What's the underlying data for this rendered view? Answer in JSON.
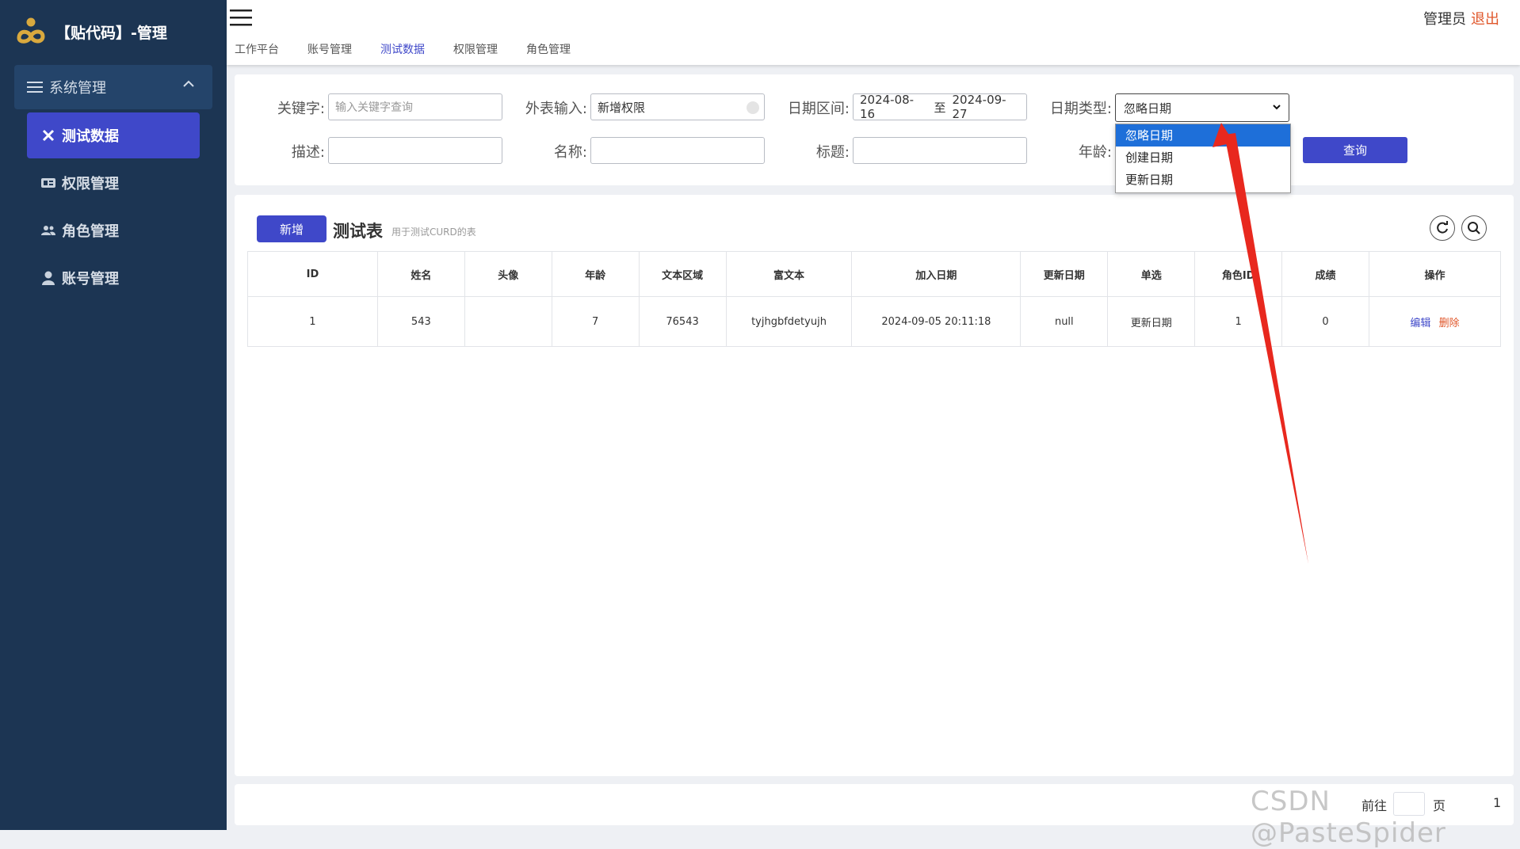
{
  "app": {
    "title": "【贴代码】-管理"
  },
  "sidebar": {
    "group_label": "系统管理",
    "items": [
      {
        "label": "测试数据",
        "icon": "close-icon",
        "active": true
      },
      {
        "label": "权限管理",
        "icon": "id-card-icon",
        "active": false
      },
      {
        "label": "角色管理",
        "icon": "users-icon",
        "active": false
      },
      {
        "label": "账号管理",
        "icon": "user-icon",
        "active": false
      }
    ]
  },
  "header": {
    "user": "管理员",
    "logout": "退出",
    "tabs": [
      {
        "label": "工作平台"
      },
      {
        "label": "账号管理"
      },
      {
        "label": "测试数据",
        "active": true
      },
      {
        "label": "权限管理"
      },
      {
        "label": "角色管理"
      }
    ]
  },
  "search": {
    "keyword_label": "关键字:",
    "keyword_placeholder": "输入关键字查询",
    "foreign_label": "外表输入:",
    "foreign_value": "新增权限",
    "date_range_label": "日期区间:",
    "date_start": "2024-08-16",
    "date_sep": "至",
    "date_end": "2024-09-27",
    "date_type_label": "日期类型:",
    "date_type_value": "忽略日期",
    "date_type_options": [
      "忽略日期",
      "创建日期",
      "更新日期"
    ],
    "desc_label": "描述:",
    "name_label": "名称:",
    "title_label": "标题:",
    "age_label": "年龄:",
    "query_button": "查询"
  },
  "table": {
    "add_button": "新增",
    "title": "测试表",
    "subtitle": "用于测试CURD的表",
    "columns": [
      "ID",
      "姓名",
      "头像",
      "年龄",
      "文本区域",
      "富文本",
      "加入日期",
      "更新日期",
      "单选",
      "角色ID",
      "成绩",
      "操作"
    ],
    "rows": [
      {
        "id": "1",
        "name": "543",
        "avatar": "",
        "age": "7",
        "textarea": "76543",
        "richtext": "tyjhgbfdetyujh",
        "join_date": "2024-09-05 20:11:18",
        "update_date": "null",
        "radio": "更新日期",
        "role_id": "1",
        "score": "0",
        "edit": "编辑",
        "delete": "删除"
      }
    ]
  },
  "pager": {
    "goto": "前往",
    "page_unit": "页",
    "page_num": "1"
  },
  "watermark": "CSDN @PasteSpider",
  "colors": {
    "sidebar_bg": "#1c3553",
    "accent": "#3f48c9",
    "danger": "#e0572b",
    "annotation_arrow": "#e8281e"
  }
}
